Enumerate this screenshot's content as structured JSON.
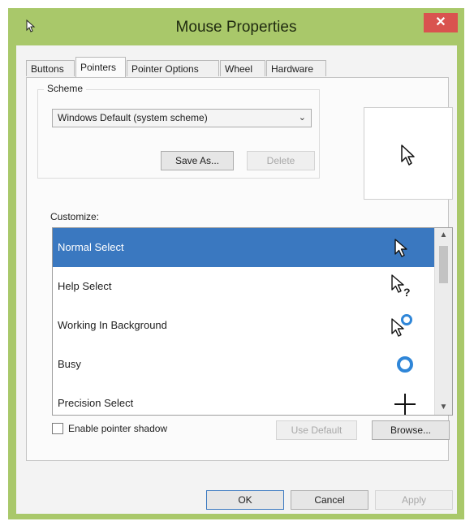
{
  "window": {
    "title": "Mouse Properties",
    "close_glyph": "✕",
    "app_icon": "mouse-icon"
  },
  "tabs": [
    {
      "label": "Buttons",
      "active": false
    },
    {
      "label": "Pointers",
      "active": true
    },
    {
      "label": "Pointer Options",
      "active": false
    },
    {
      "label": "Wheel",
      "active": false
    },
    {
      "label": "Hardware",
      "active": false
    }
  ],
  "scheme": {
    "label": "Scheme",
    "selected": "Windows Default (system scheme)",
    "save_as": "Save As...",
    "delete": "Delete"
  },
  "customize": {
    "label": "Customize:",
    "items": [
      {
        "label": "Normal Select",
        "icon": "arrow-cursor-icon",
        "selected": true
      },
      {
        "label": "Help Select",
        "icon": "help-cursor-icon",
        "selected": false
      },
      {
        "label": "Working In Background",
        "icon": "working-cursor-icon",
        "selected": false
      },
      {
        "label": "Busy",
        "icon": "busy-cursor-icon",
        "selected": false
      },
      {
        "label": "Precision Select",
        "icon": "crosshair-cursor-icon",
        "selected": false
      }
    ]
  },
  "options": {
    "shadow_label": "Enable pointer shadow",
    "shadow_checked": false,
    "use_default": "Use Default",
    "browse": "Browse..."
  },
  "footer": {
    "ok": "OK",
    "cancel": "Cancel",
    "apply": "Apply"
  },
  "colors": {
    "frame": "#a9c86a",
    "selection": "#3a78c0",
    "close": "#d9534f"
  }
}
